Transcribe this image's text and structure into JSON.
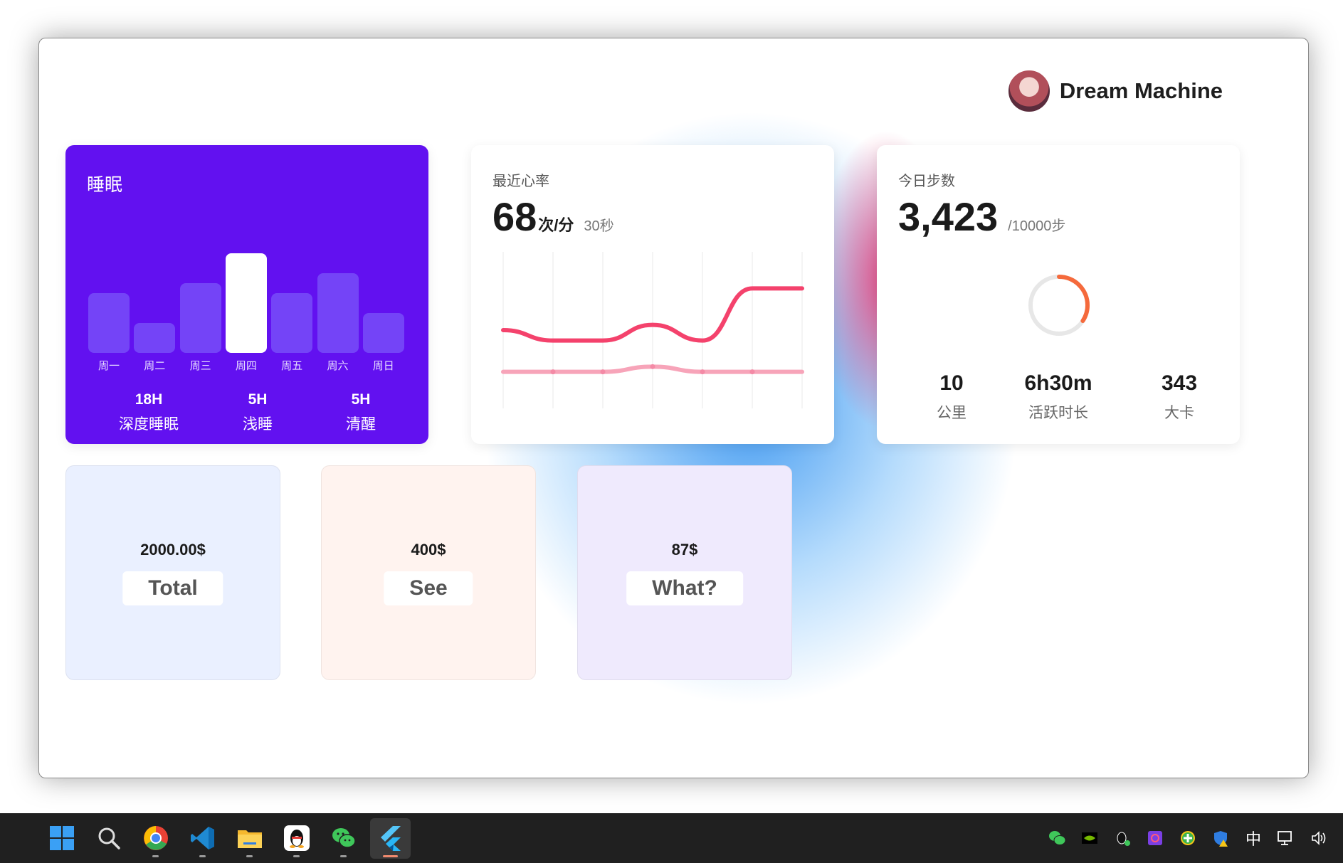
{
  "user": {
    "name": "Dream Machine"
  },
  "sleep_card": {
    "title": "睡眠",
    "chart_data": {
      "type": "bar",
      "categories": [
        "周一",
        "周二",
        "周三",
        "周四",
        "周五",
        "周六",
        "周日"
      ],
      "values": [
        6,
        3,
        7,
        10,
        6,
        8,
        4
      ],
      "highlighted": "周四"
    },
    "stats": [
      {
        "value": "18H",
        "label": "深度睡眠"
      },
      {
        "value": "5H",
        "label": "浅睡"
      },
      {
        "value": "5H",
        "label": "清醒"
      }
    ]
  },
  "heart_card": {
    "title": "最近心率",
    "value": "68",
    "unit": "次/分",
    "sub": "30秒",
    "chart_data": {
      "type": "line",
      "x": [
        0,
        1,
        2,
        3,
        4,
        5,
        6
      ],
      "series": [
        {
          "values": [
            70,
            68,
            68,
            71,
            68,
            78,
            78
          ],
          "color": "#f4426c"
        },
        {
          "values": [
            62,
            62,
            62,
            63,
            62,
            62,
            62
          ],
          "color": "#f7a4b9"
        }
      ]
    }
  },
  "steps_card": {
    "title": "今日步数",
    "value": "3,423",
    "goal": "/10000步",
    "progress": 0.3423,
    "colors": {
      "track": "#e7e7e7",
      "progress": "#f56a3c"
    },
    "stats": [
      {
        "value": "10",
        "label": "公里"
      },
      {
        "value": "6h30m",
        "label": "活跃时长"
      },
      {
        "value": "343",
        "label": "大卡"
      }
    ]
  },
  "mini_cards": [
    {
      "amount": "2000.00$",
      "button": "Total"
    },
    {
      "amount": "400$",
      "button": "See"
    },
    {
      "amount": "87$",
      "button": "What?"
    }
  ],
  "taskbar": {
    "apps": [
      "windows-start-icon",
      "search-icon",
      "chrome-icon",
      "vscode-icon",
      "file-explorer-icon",
      "qq-icon",
      "wechat-icon",
      "flutter-icon"
    ],
    "tray_ime": "中"
  }
}
